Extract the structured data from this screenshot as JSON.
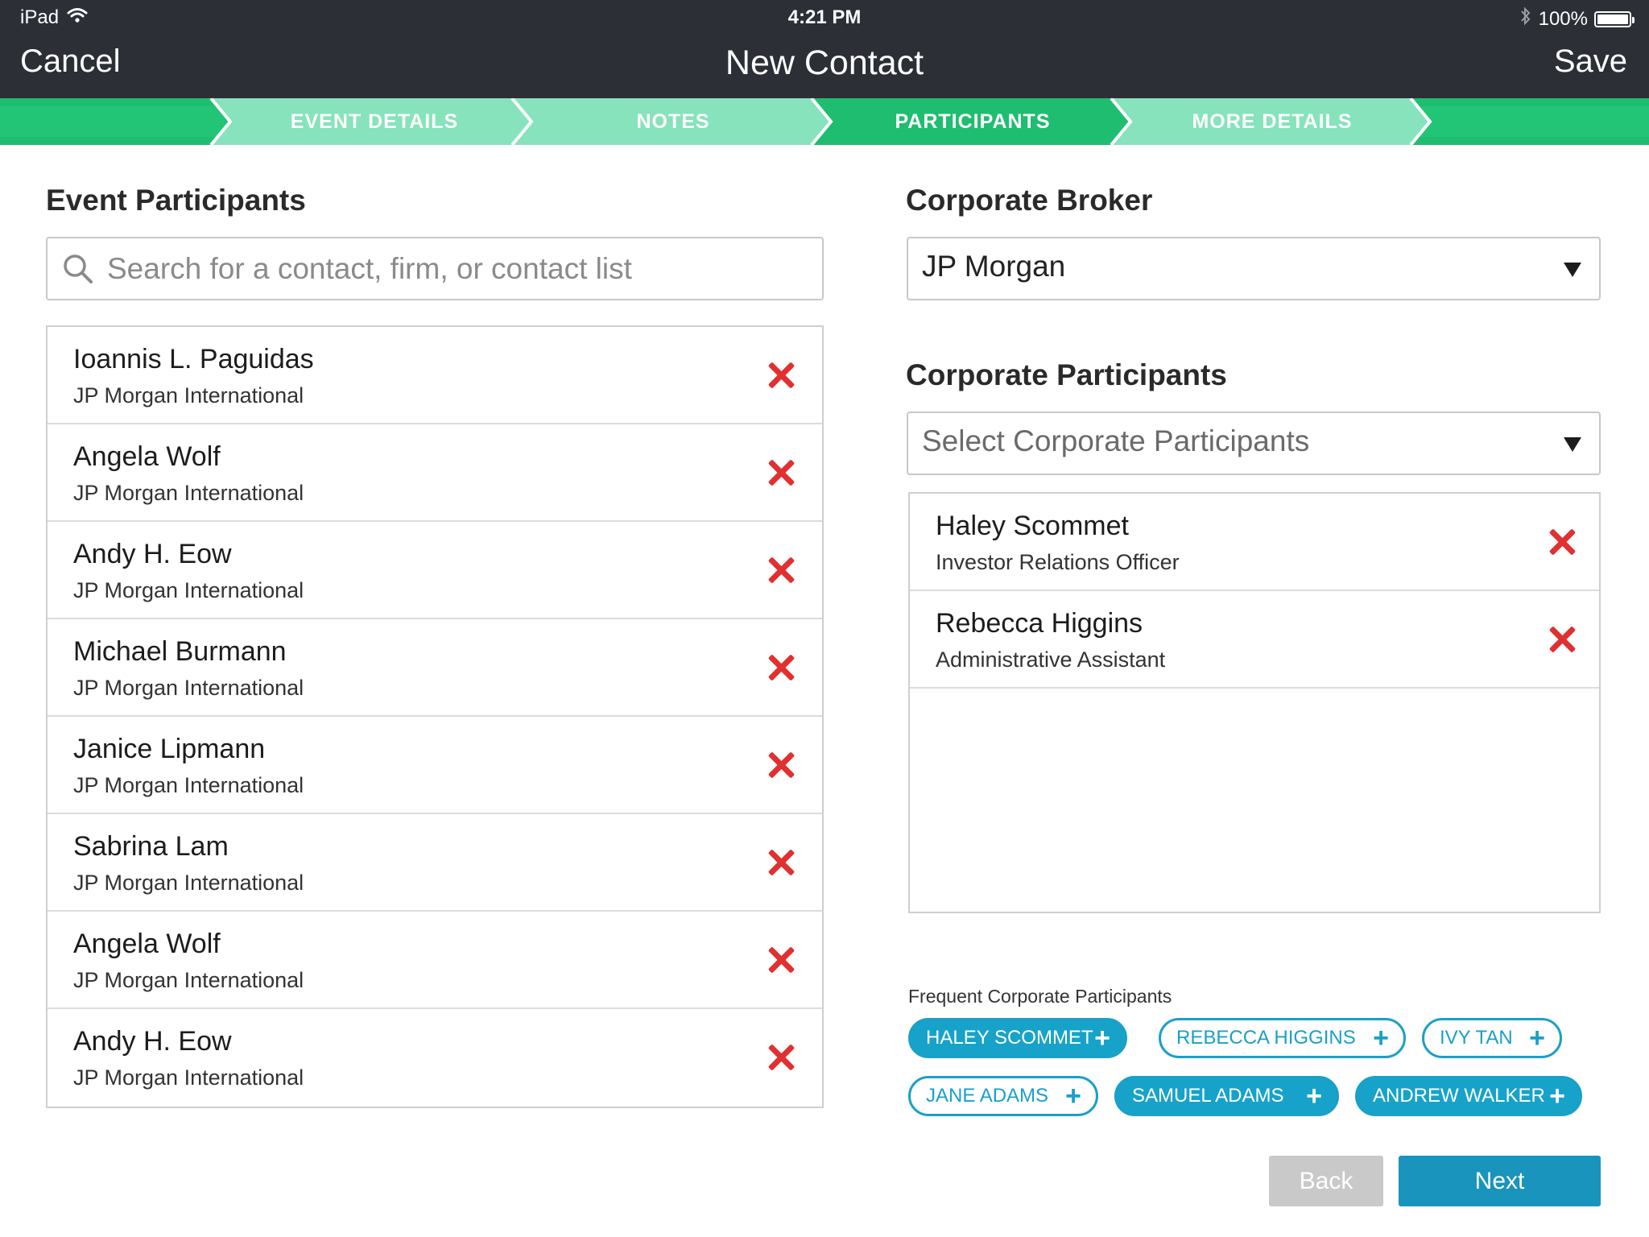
{
  "status_bar": {
    "carrier": "iPad",
    "time": "4:21 PM",
    "battery": "100%",
    "battery_level": 1.0
  },
  "nav": {
    "cancel": "Cancel",
    "title": "New Contact",
    "save": "Save"
  },
  "steps": [
    {
      "label": "EVENT DETAILS",
      "state": "completed"
    },
    {
      "label": "NOTES",
      "state": "completed"
    },
    {
      "label": "PARTICIPANTS",
      "state": "active"
    },
    {
      "label": "MORE DETAILS",
      "state": "upcoming"
    }
  ],
  "colors": {
    "nav_bg": "#2c2f36",
    "step_dark": "#1fbd6f",
    "step_light": "#86e3bc",
    "remove": "#e0302f",
    "accent": "#17a3c9",
    "next_button": "#1894bd",
    "back_button": "#c9c9c9"
  },
  "event_participants": {
    "title": "Event Participants",
    "search_placeholder": "Search for a contact, firm, or contact list",
    "items": [
      {
        "name": "Ioannis L. Paguidas",
        "firm": "JP Morgan International"
      },
      {
        "name": "Angela Wolf",
        "firm": "JP Morgan International"
      },
      {
        "name": "Andy H. Eow",
        "firm": "JP Morgan International"
      },
      {
        "name": "Michael Burmann",
        "firm": "JP Morgan International"
      },
      {
        "name": "Janice Lipmann",
        "firm": "JP Morgan International"
      },
      {
        "name": "Sabrina Lam",
        "firm": "JP Morgan International"
      },
      {
        "name": "Angela Wolf",
        "firm": "JP Morgan International"
      },
      {
        "name": "Andy H. Eow",
        "firm": "JP Morgan International"
      }
    ]
  },
  "corporate_broker": {
    "title": "Corporate Broker",
    "selected": "JP Morgan"
  },
  "corporate_participants": {
    "title": "Corporate Participants",
    "placeholder": "Select Corporate Participants",
    "items": [
      {
        "name": "Haley Scommet",
        "role": "Investor Relations Officer"
      },
      {
        "name": "Rebecca Higgins",
        "role": "Administrative Assistant"
      }
    ]
  },
  "frequent": {
    "title": "Frequent Corporate Participants",
    "chips": [
      {
        "label": "HALEY SCOMMET",
        "selected": true
      },
      {
        "label": "REBECCA HIGGINS",
        "selected": false
      },
      {
        "label": "IVY TAN",
        "selected": false
      },
      {
        "label": "JANE ADAMS",
        "selected": false
      },
      {
        "label": "SAMUEL ADAMS",
        "selected": true
      },
      {
        "label": "ANDREW WALKER",
        "selected": true
      }
    ]
  },
  "buttons": {
    "back": "Back",
    "next": "Next"
  }
}
